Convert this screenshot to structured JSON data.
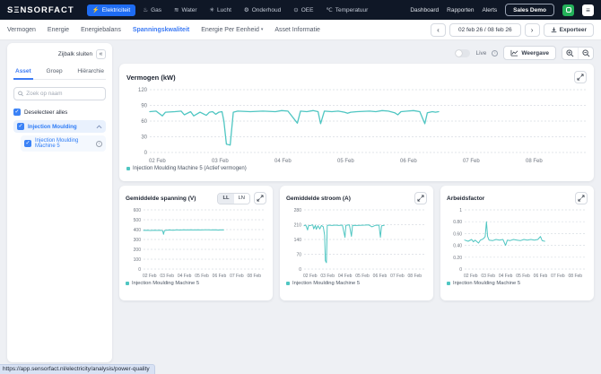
{
  "colors": {
    "accent_teal": "#4fc6c2",
    "accent_blue": "#1e6cf2",
    "tab_active": "#3d7bf4",
    "topbar_bg": "#0f1726"
  },
  "topnav": {
    "logo": "SΞNSORFACT",
    "items": [
      {
        "label": "Elektriciteit",
        "icon": "electricity-icon",
        "glyph": "⚡",
        "active": true
      },
      {
        "label": "Gas",
        "icon": "gas-icon",
        "glyph": "♨",
        "active": false
      },
      {
        "label": "Water",
        "icon": "water-icon",
        "glyph": "≋",
        "active": false
      },
      {
        "label": "Lucht",
        "icon": "air-icon",
        "glyph": "✳",
        "active": false
      },
      {
        "label": "Onderhoud",
        "icon": "maintenance-icon",
        "glyph": "⚙",
        "active": false
      },
      {
        "label": "OEE",
        "icon": "oee-icon",
        "glyph": "⊙",
        "active": false
      },
      {
        "label": "Temperatuur",
        "icon": "temperature-icon",
        "glyph": "℃",
        "active": false
      }
    ],
    "links": [
      "Dashboard",
      "Rapporten",
      "Alerts"
    ],
    "sales_demo_label": "Sales Demo",
    "menu_glyph": "≡"
  },
  "tabbar": {
    "tabs": [
      "Vermogen",
      "Energie",
      "Energiebalans",
      "Spanningskwaliteit",
      "Energie Per Eenheid",
      "Asset Informatie"
    ],
    "active_tab": "Spanningskwaliteit",
    "dropdown_chevron": "▾",
    "prev_glyph": "‹",
    "next_glyph": "›",
    "date_range": "02 feb 26 / 08 feb 26",
    "export_label": "Exporteer"
  },
  "sidebar": {
    "close_label": "Zijbalk sluiten",
    "close_glyph": "«",
    "tabs": [
      "Asset",
      "Groep",
      "Hiërarchie"
    ],
    "active_tab": "Asset",
    "search_placeholder": "Zoek op naam",
    "check_glyph": "✓",
    "deselect_label": "Deselecteer alles",
    "tree": [
      {
        "label": "Injection Moulding",
        "checked": true,
        "expanded": true
      },
      {
        "label": "Injection Moulding Machine 5",
        "checked": true,
        "info": "i"
      }
    ]
  },
  "controls": {
    "live_label": "Live",
    "info_glyph": "i",
    "view_label": "Weergave"
  },
  "statusbar": {
    "url": "https://app.sensorfact.nl/electricity/analysis/power-quality"
  },
  "chart_data": [
    {
      "key": "vermogen",
      "type": "line",
      "title": "Vermogen (kW)",
      "legend": "Injection Moulding Machine 5 (Actief vermogen)",
      "xlim": [
        0,
        6.9
      ],
      "ylim": [
        0,
        120
      ],
      "yticks": {
        "values": [
          0,
          30,
          60,
          90,
          120
        ],
        "labels": [
          "0",
          "30",
          "60",
          "90",
          "120"
        ]
      },
      "xticks": {
        "positions": [
          0,
          1,
          2,
          3,
          4,
          5,
          6
        ],
        "labels": [
          "02 Feb",
          "03 Feb",
          "04 Feb",
          "05 Feb",
          "06 Feb",
          "07 Feb",
          "08 Feb"
        ]
      },
      "grid": true,
      "legend_position": "bottom",
      "series": [
        {
          "name": "Injection Moulding Machine 5 (Actief vermogen)",
          "color": "#4fc6c2",
          "points": [
            [
              0,
              78
            ],
            [
              0.1,
              79
            ],
            [
              0.2,
              70
            ],
            [
              0.25,
              77
            ],
            [
              0.4,
              78
            ],
            [
              0.5,
              79
            ],
            [
              0.55,
              72
            ],
            [
              0.65,
              78
            ],
            [
              0.7,
              70
            ],
            [
              0.8,
              77
            ],
            [
              0.9,
              71
            ],
            [
              0.95,
              77
            ],
            [
              1.0,
              78
            ],
            [
              1.05,
              73
            ],
            [
              1.1,
              77
            ],
            [
              1.15,
              78
            ],
            [
              1.18,
              60
            ],
            [
              1.22,
              16
            ],
            [
              1.28,
              14
            ],
            [
              1.33,
              77
            ],
            [
              1.4,
              79
            ],
            [
              1.6,
              78
            ],
            [
              1.8,
              79
            ],
            [
              2.0,
              78
            ],
            [
              2.1,
              80
            ],
            [
              2.2,
              79
            ],
            [
              2.35,
              56
            ],
            [
              2.4,
              79
            ],
            [
              2.5,
              78
            ],
            [
              2.6,
              80
            ],
            [
              2.68,
              78
            ],
            [
              2.72,
              55
            ],
            [
              2.78,
              79
            ],
            [
              2.9,
              78
            ],
            [
              3.0,
              79
            ],
            [
              3.1,
              77
            ],
            [
              3.15,
              75
            ],
            [
              3.2,
              77
            ],
            [
              3.3,
              78
            ],
            [
              3.5,
              79
            ],
            [
              3.6,
              78
            ],
            [
              3.7,
              80
            ],
            [
              3.8,
              79
            ],
            [
              3.9,
              76
            ],
            [
              3.95,
              72
            ],
            [
              4.0,
              78
            ],
            [
              4.1,
              79
            ],
            [
              4.2,
              80
            ],
            [
              4.3,
              78
            ],
            [
              4.38,
              55
            ],
            [
              4.42,
              76
            ],
            [
              4.5,
              78
            ],
            [
              4.55,
              77
            ],
            [
              4.6,
              78
            ]
          ]
        }
      ]
    },
    {
      "key": "spanning",
      "type": "line",
      "title": "Gemiddelde spanning (V)",
      "legend": "Injection Moulding Machine 5",
      "toggle": {
        "options": [
          "LL",
          "LN"
        ],
        "active": "LL"
      },
      "xlim": [
        0,
        6.9
      ],
      "ylim": [
        0,
        600
      ],
      "yticks": {
        "values": [
          0,
          100,
          200,
          300,
          400,
          500,
          600
        ],
        "labels": [
          "0",
          "100",
          "200",
          "300",
          "400",
          "500",
          "600"
        ]
      },
      "xticks": {
        "positions": [
          0,
          1,
          2,
          3,
          4,
          5,
          6
        ],
        "labels": [
          "02 Feb",
          "03 Feb",
          "04 Feb",
          "05 Feb",
          "06 Feb",
          "07 Feb",
          "08 Feb"
        ]
      },
      "grid": true,
      "legend_position": "bottom",
      "series": [
        {
          "name": "Injection Moulding Machine 5",
          "color": "#4fc6c2",
          "points": [
            [
              0,
              392
            ],
            [
              0.2,
              394
            ],
            [
              0.4,
              391
            ],
            [
              0.6,
              394
            ],
            [
              0.8,
              392
            ],
            [
              1.0,
              393
            ],
            [
              1.1,
              388
            ],
            [
              1.15,
              352
            ],
            [
              1.2,
              390
            ],
            [
              1.3,
              394
            ],
            [
              1.5,
              396
            ],
            [
              1.7,
              394
            ],
            [
              1.9,
              397
            ],
            [
              2.1,
              395
            ],
            [
              2.3,
              397
            ],
            [
              2.5,
              396
            ],
            [
              2.7,
              398
            ],
            [
              2.9,
              396
            ],
            [
              3.1,
              397
            ],
            [
              3.3,
              396
            ],
            [
              3.5,
              398
            ],
            [
              3.7,
              397
            ],
            [
              3.9,
              396
            ],
            [
              4.1,
              397
            ],
            [
              4.3,
              395
            ],
            [
              4.5,
              397
            ],
            [
              4.6,
              396
            ]
          ]
        }
      ]
    },
    {
      "key": "stroom",
      "type": "line",
      "title": "Gemiddelde stroom (A)",
      "legend": "Injection Moulding Machine 5",
      "xlim": [
        0,
        6.9
      ],
      "ylim": [
        0,
        280
      ],
      "yticks": {
        "values": [
          0,
          70,
          140,
          210,
          280
        ],
        "labels": [
          "0",
          "70",
          "140",
          "210",
          "280"
        ]
      },
      "xticks": {
        "positions": [
          0,
          1,
          2,
          3,
          4,
          5,
          6
        ],
        "labels": [
          "02 Feb",
          "03 Feb",
          "04 Feb",
          "05 Feb",
          "06 Feb",
          "07 Feb",
          "08 Feb"
        ]
      },
      "grid": true,
      "legend_position": "bottom",
      "series": [
        {
          "name": "Injection Moulding Machine 5",
          "color": "#4fc6c2",
          "points": [
            [
              0,
              205
            ],
            [
              0.1,
              208
            ],
            [
              0.2,
              185
            ],
            [
              0.25,
              205
            ],
            [
              0.4,
              207
            ],
            [
              0.5,
              209
            ],
            [
              0.55,
              190
            ],
            [
              0.65,
              206
            ],
            [
              0.7,
              188
            ],
            [
              0.8,
              205
            ],
            [
              0.9,
              190
            ],
            [
              1.0,
              206
            ],
            [
              1.1,
              200
            ],
            [
              1.18,
              160
            ],
            [
              1.22,
              40
            ],
            [
              1.28,
              30
            ],
            [
              1.33,
              205
            ],
            [
              1.4,
              208
            ],
            [
              1.6,
              206
            ],
            [
              1.8,
              208
            ],
            [
              2.0,
              206
            ],
            [
              2.2,
              208
            ],
            [
              2.35,
              150
            ],
            [
              2.4,
              207
            ],
            [
              2.6,
              209
            ],
            [
              2.72,
              155
            ],
            [
              2.78,
              207
            ],
            [
              3.0,
              206
            ],
            [
              3.2,
              207
            ],
            [
              3.5,
              208
            ],
            [
              3.7,
              209
            ],
            [
              3.9,
              200
            ],
            [
              4.1,
              207
            ],
            [
              4.3,
              208
            ],
            [
              4.38,
              150
            ],
            [
              4.45,
              205
            ],
            [
              4.6,
              207
            ]
          ]
        }
      ]
    },
    {
      "key": "arbeidsfactor",
      "type": "line",
      "title": "Arbeidsfactor",
      "legend": "Injection Moulding Machine 5",
      "xlim": [
        0,
        6.9
      ],
      "ylim": [
        0,
        1
      ],
      "yticks": {
        "values": [
          0,
          0.2,
          0.4,
          0.6,
          0.8,
          1
        ],
        "labels": [
          "0",
          "0.20",
          "0.40",
          "0.60",
          "0.80",
          "1"
        ]
      },
      "xticks": {
        "positions": [
          0,
          1,
          2,
          3,
          4,
          5,
          6
        ],
        "labels": [
          "02 Feb",
          "03 Feb",
          "04 Feb",
          "05 Feb",
          "06 Feb",
          "07 Feb",
          "08 Feb"
        ]
      },
      "grid": true,
      "legend_position": "bottom",
      "series": [
        {
          "name": "Injection Moulding Machine 5",
          "color": "#4fc6c2",
          "points": [
            [
              0,
              0.49
            ],
            [
              0.2,
              0.47
            ],
            [
              0.4,
              0.5
            ],
            [
              0.5,
              0.46
            ],
            [
              0.6,
              0.49
            ],
            [
              0.8,
              0.44
            ],
            [
              0.9,
              0.49
            ],
            [
              1.0,
              0.5
            ],
            [
              1.1,
              0.52
            ],
            [
              1.18,
              0.55
            ],
            [
              1.25,
              0.8
            ],
            [
              1.32,
              0.55
            ],
            [
              1.4,
              0.49
            ],
            [
              1.6,
              0.48
            ],
            [
              1.8,
              0.5
            ],
            [
              2.0,
              0.49
            ],
            [
              2.2,
              0.5
            ],
            [
              2.35,
              0.4
            ],
            [
              2.45,
              0.49
            ],
            [
              2.6,
              0.48
            ],
            [
              2.8,
              0.5
            ],
            [
              3.0,
              0.49
            ],
            [
              3.2,
              0.48
            ],
            [
              3.4,
              0.5
            ],
            [
              3.6,
              0.49
            ],
            [
              3.8,
              0.5
            ],
            [
              4.0,
              0.49
            ],
            [
              4.2,
              0.5
            ],
            [
              4.35,
              0.55
            ],
            [
              4.45,
              0.48
            ],
            [
              4.6,
              0.47
            ]
          ]
        }
      ]
    }
  ]
}
